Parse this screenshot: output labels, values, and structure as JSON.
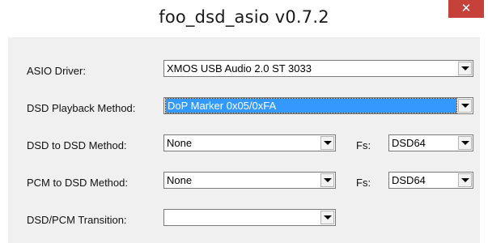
{
  "window": {
    "title": "foo_dsd_asio v0.7.2",
    "close_glyph": "✕"
  },
  "rows": {
    "asio_driver": {
      "label": "ASIO Driver:",
      "value": "XMOS USB Audio 2.0 ST 3033"
    },
    "dsd_playback": {
      "label": "DSD Playback Method:",
      "value": "DoP Marker 0x05/0xFA"
    },
    "dsd_to_dsd": {
      "label": "DSD to DSD Method:",
      "value": "None",
      "fs_label": "Fs:",
      "fs_value": "DSD64"
    },
    "pcm_to_dsd": {
      "label": "PCM to DSD Method:",
      "value": "None",
      "fs_label": "Fs:",
      "fs_value": "DSD64"
    },
    "transition": {
      "label": "DSD/PCM Transition:",
      "value": ""
    }
  },
  "colors": {
    "close_button": "#c7413b",
    "selection": "#3399ff",
    "dialog_bg": "#f0f0f0"
  }
}
